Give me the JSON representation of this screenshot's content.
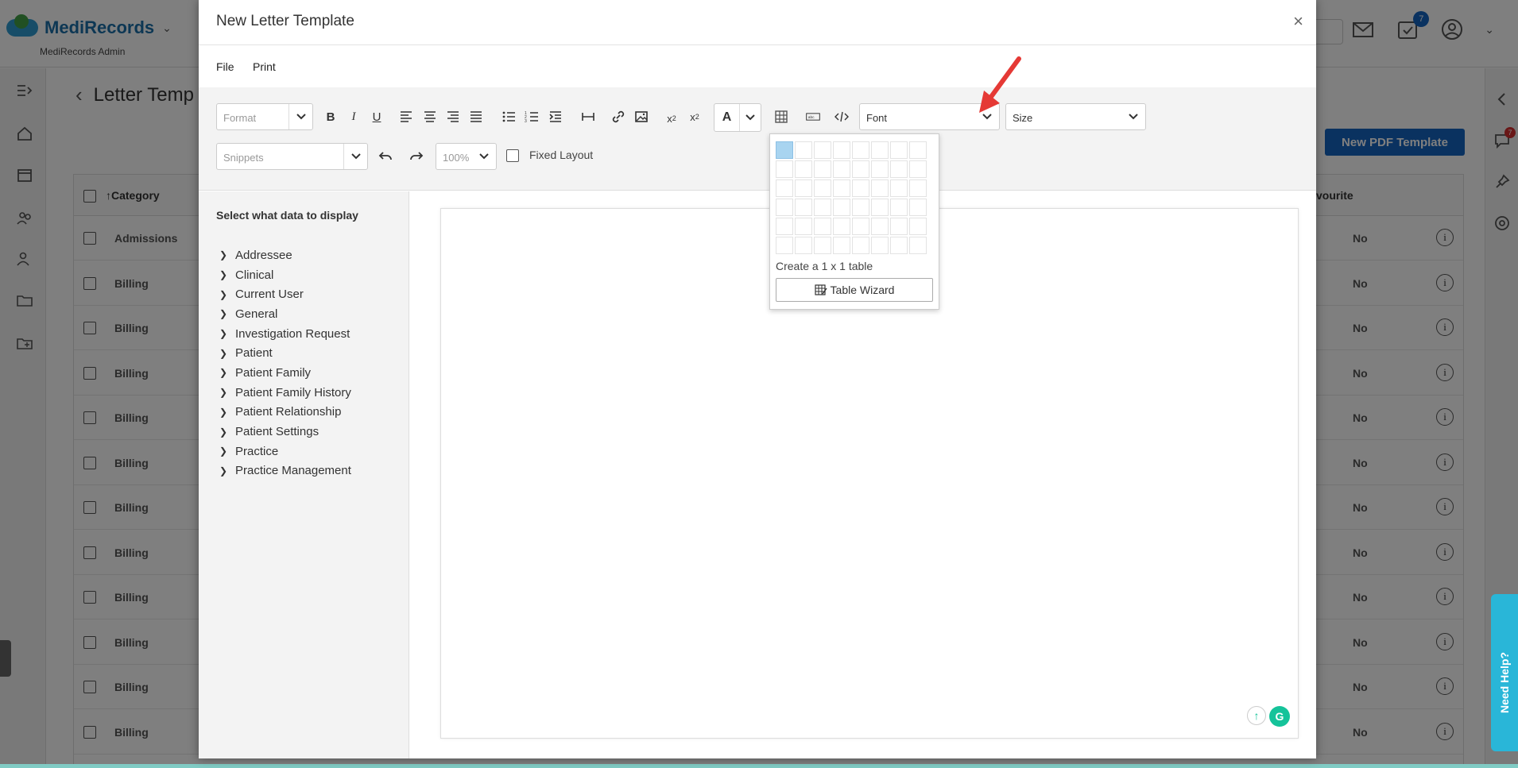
{
  "app": {
    "brand": "MediRecords",
    "subtitle": "MediRecords Admin",
    "notification_count": "7",
    "side_badge": "7"
  },
  "page": {
    "title": "Letter Temp",
    "new_pdf_button": "New PDF Template"
  },
  "table": {
    "col_category": "Category",
    "col_favourite": "vourite",
    "rows": [
      {
        "category": "Admissions",
        "favourite": "No"
      },
      {
        "category": "Billing",
        "favourite": "No"
      },
      {
        "category": "Billing",
        "favourite": "No"
      },
      {
        "category": "Billing",
        "favourite": "No"
      },
      {
        "category": "Billing",
        "favourite": "No"
      },
      {
        "category": "Billing",
        "favourite": "No"
      },
      {
        "category": "Billing",
        "favourite": "No"
      },
      {
        "category": "Billing",
        "favourite": "No"
      },
      {
        "category": "Billing",
        "favourite": "No"
      },
      {
        "category": "Billing",
        "favourite": "No"
      },
      {
        "category": "Billing",
        "favourite": "No"
      },
      {
        "category": "Billing",
        "favourite": "No"
      }
    ]
  },
  "need_help": "Need Help?",
  "modal": {
    "title": "New Letter Template",
    "close": "×",
    "menu": {
      "file": "File",
      "print": "Print"
    },
    "toolbar": {
      "format_placeholder": "Format",
      "snippets_placeholder": "Snippets",
      "zoom": "100%",
      "font": "Font",
      "size": "Size",
      "color_letter": "A",
      "fixed_layout": "Fixed Layout"
    },
    "sidebar": {
      "title": "Select what data to display",
      "items": [
        "Addressee",
        "Clinical",
        "Current User",
        "General",
        "Investigation Request",
        "Patient",
        "Patient Family",
        "Patient Family History",
        "Patient Relationship",
        "Patient Settings",
        "Practice",
        "Practice Management"
      ]
    },
    "table_picker": {
      "selected_rows": 1,
      "selected_cols": 1,
      "label": "Create a 1 x 1 table",
      "wizard_button": "Table Wizard"
    }
  },
  "colors": {
    "accent": "#1565c0",
    "grid_selected": "#a8d4f0",
    "arrow": "#e53935",
    "help": "#29b6d8"
  }
}
